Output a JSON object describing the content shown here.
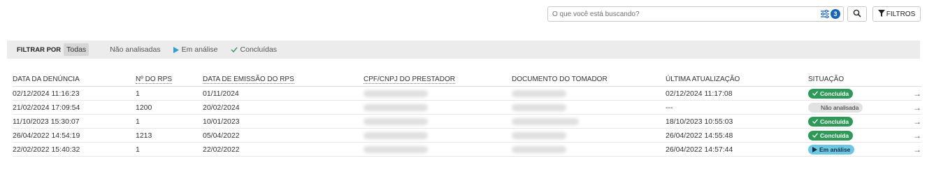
{
  "search": {
    "placeholder": "O que você está buscando?",
    "filter_count": "3",
    "filtros_label": "FILTROS"
  },
  "filter_bar": {
    "label": "FILTRAR POR",
    "options": [
      "Todas",
      "Não analisadas",
      "Em análise",
      "Concluídas"
    ]
  },
  "table": {
    "headers": [
      "DATA DA DENÚNCIA",
      "Nº DO RPS",
      "DATA DE EMISSÃO DO RPS",
      "CPF/CNPJ DO PRESTADOR",
      "DOCUMENTO DO TOMADOR",
      "ÚLTIMA ATUALIZAÇÃO",
      "SITUAÇÃO"
    ],
    "rows": [
      {
        "data_denuncia": "02/12/2024 11:16:23",
        "num_rps": "1",
        "data_emissao": "01/11/2024",
        "ultima_atualizacao": "02/12/2024 11:17:08",
        "situacao": "Concluída"
      },
      {
        "data_denuncia": "21/02/2024 17:09:54",
        "num_rps": "1200",
        "data_emissao": "20/02/2024",
        "ultima_atualizacao": "---",
        "situacao": "Não analisada"
      },
      {
        "data_denuncia": "11/10/2023 15:30:07",
        "num_rps": "1",
        "data_emissao": "10/01/2023",
        "ultima_atualizacao": "18/10/2023 10:55:03",
        "situacao": "Concluída"
      },
      {
        "data_denuncia": "26/04/2022 14:54:19",
        "num_rps": "1213",
        "data_emissao": "05/04/2022",
        "ultima_atualizacao": "26/04/2022 14:55:48",
        "situacao": "Concluída"
      },
      {
        "data_denuncia": "22/02/2022 15:40:32",
        "num_rps": "1",
        "data_emissao": "22/02/2022",
        "ultima_atualizacao": "26/04/2022 14:57:44",
        "situacao": "Em análise"
      }
    ],
    "row_arrow": "→"
  },
  "colors": {
    "done": "#2e9a57",
    "review": "#6cc7e6",
    "pending": "#e2e2e2",
    "accent": "#1565c0"
  },
  "icons": [
    "sliders-icon",
    "search-icon",
    "funnel-icon",
    "play-icon",
    "check-icon",
    "arrow-right-icon"
  ]
}
